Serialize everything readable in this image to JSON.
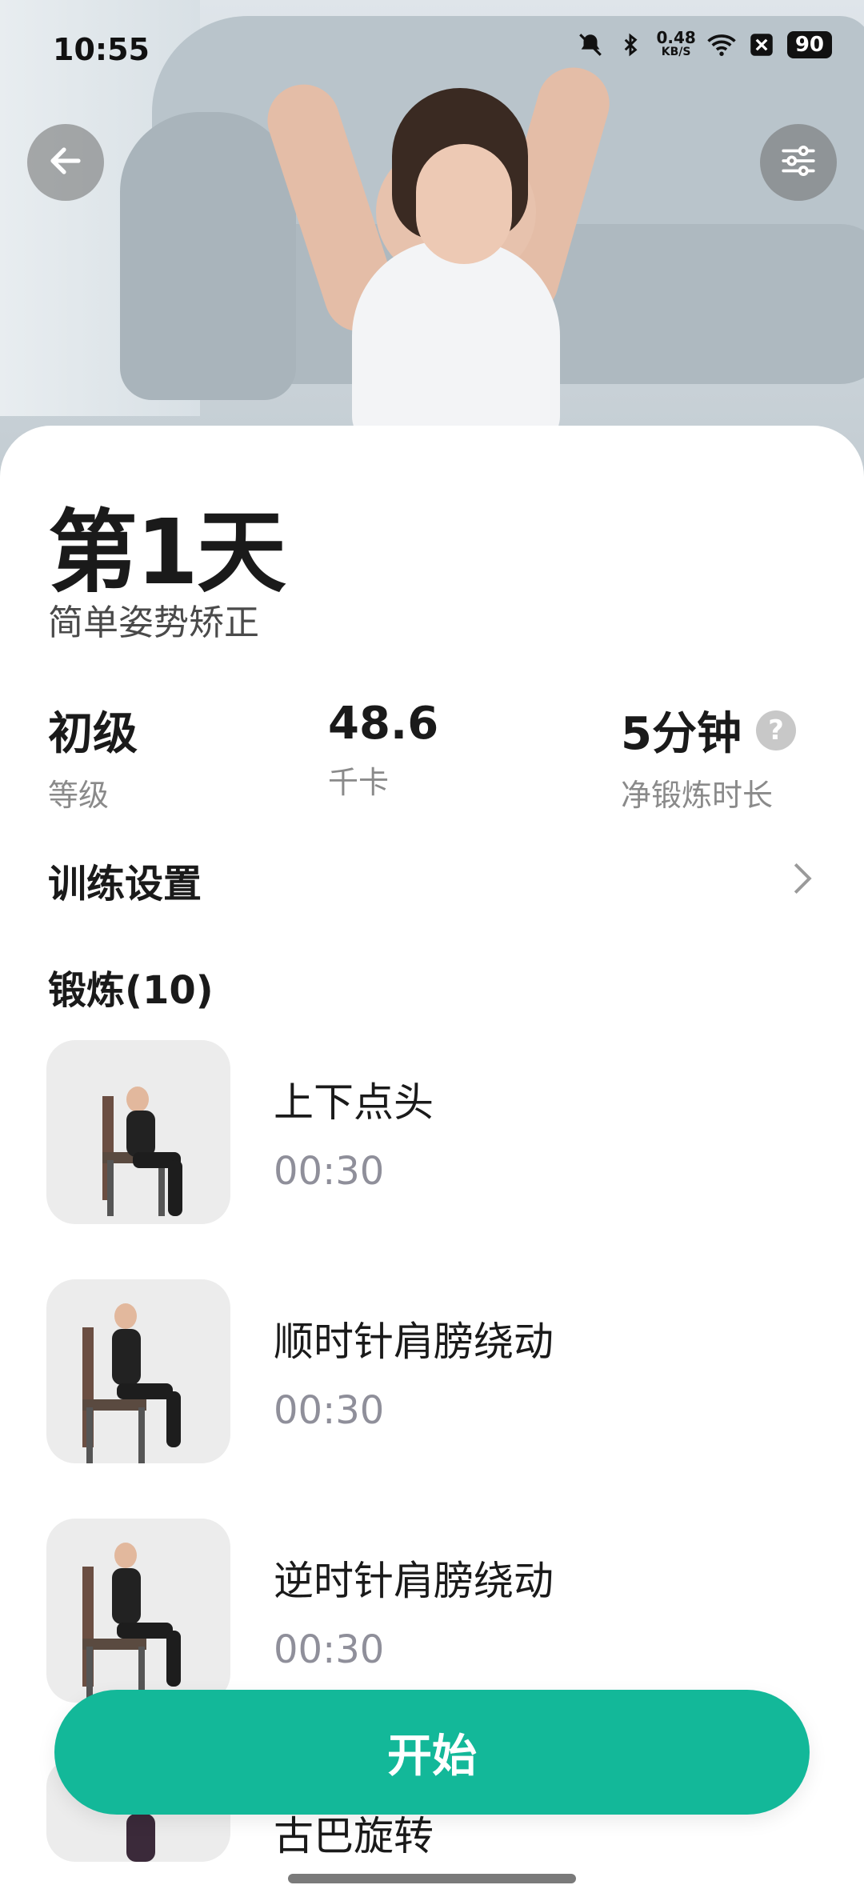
{
  "status_bar": {
    "time": "10:55",
    "net_speed_value": "0.48",
    "net_speed_unit": "KB/S",
    "battery": "90",
    "icons": [
      "bell-off-icon",
      "bluetooth-icon",
      "wifi-icon",
      "close-box-icon"
    ]
  },
  "header": {
    "back_icon": "arrow-left-icon",
    "filter_icon": "sliders-icon"
  },
  "workout": {
    "title": "第1天",
    "subtitle": "简单姿势矫正",
    "stats": [
      {
        "value": "初级",
        "label": "等级"
      },
      {
        "value": "48.6",
        "label": "千卡"
      },
      {
        "value": "5分钟",
        "label": "净锻炼时长"
      }
    ],
    "help_glyph": "?"
  },
  "settings": {
    "label": "训练设置"
  },
  "exercises_section": {
    "title": "锻炼(10)",
    "items": [
      {
        "name": "上下点头",
        "duration": "00:30"
      },
      {
        "name": "顺时针肩膀绕动",
        "duration": "00:30"
      },
      {
        "name": "逆时针肩膀绕动",
        "duration": "00:30"
      },
      {
        "name": "古巴旋转",
        "duration": ""
      }
    ]
  },
  "actions": {
    "start_label": "开始"
  },
  "colors": {
    "accent": "#13b899",
    "muted_text": "#8a8a8a"
  }
}
